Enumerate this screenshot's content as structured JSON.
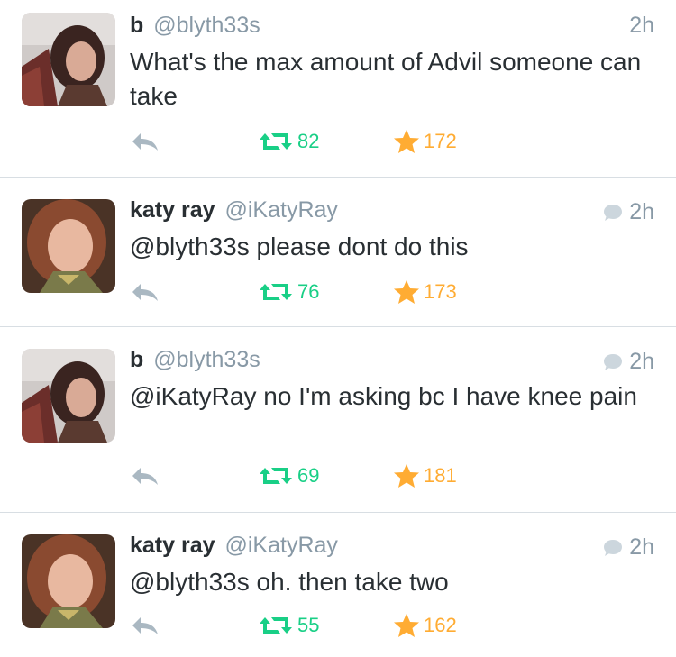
{
  "tweets": [
    {
      "name": "b",
      "handle": "@blyth33s",
      "time": "2h",
      "text": "What's the max amount of Advil someone can take",
      "retweets": "82",
      "favorites": "172",
      "avatar": "avatar-b",
      "has_reply_icon": false
    },
    {
      "name": "katy ray",
      "handle": "@iKatyRay",
      "time": "2h",
      "text": "@blyth33s please dont do this",
      "retweets": "76",
      "favorites": "173",
      "avatar": "avatar-katy",
      "has_reply_icon": true
    },
    {
      "name": "b",
      "handle": "@blyth33s",
      "time": "2h",
      "text": "@iKatyRay no I'm asking bc I have knee pain",
      "retweets": "69",
      "favorites": "181",
      "avatar": "avatar-b",
      "has_reply_icon": true
    },
    {
      "name": "katy ray",
      "handle": "@iKatyRay",
      "time": "2h",
      "text": "@blyth33s oh. then take two",
      "retweets": "55",
      "favorites": "162",
      "avatar": "avatar-katy",
      "has_reply_icon": true
    }
  ],
  "icons": {
    "reply": "reply-icon",
    "retweet": "retweet-icon",
    "favorite": "star-icon",
    "conversation": "speech-bubble-icon"
  },
  "colors": {
    "retweet": "#19cf86",
    "favorite": "#ffac33",
    "muted": "#8899a6",
    "text": "#292f33"
  }
}
